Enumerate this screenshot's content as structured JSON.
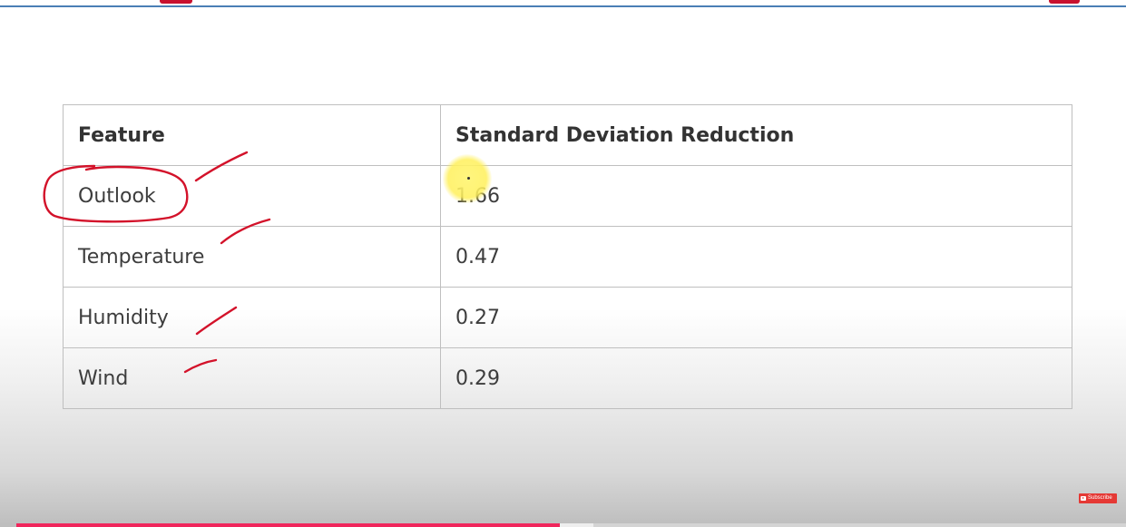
{
  "table": {
    "headers": [
      "Feature",
      "Standard Deviation Reduction"
    ],
    "rows": [
      [
        "Outlook",
        "1.66"
      ],
      [
        "Temperature",
        "0.47"
      ],
      [
        "Humidity",
        "0.27"
      ],
      [
        "Wind",
        "0.29"
      ]
    ]
  },
  "player": {
    "progress_fraction": 0.49,
    "buffered_fraction": 0.52,
    "subscribe_label": "Subscribe"
  },
  "colors": {
    "annotation_ink": "#d3122a",
    "progress": "#f0265c",
    "title_rule": "#4a7fb5",
    "highlight": "#fff35a"
  }
}
